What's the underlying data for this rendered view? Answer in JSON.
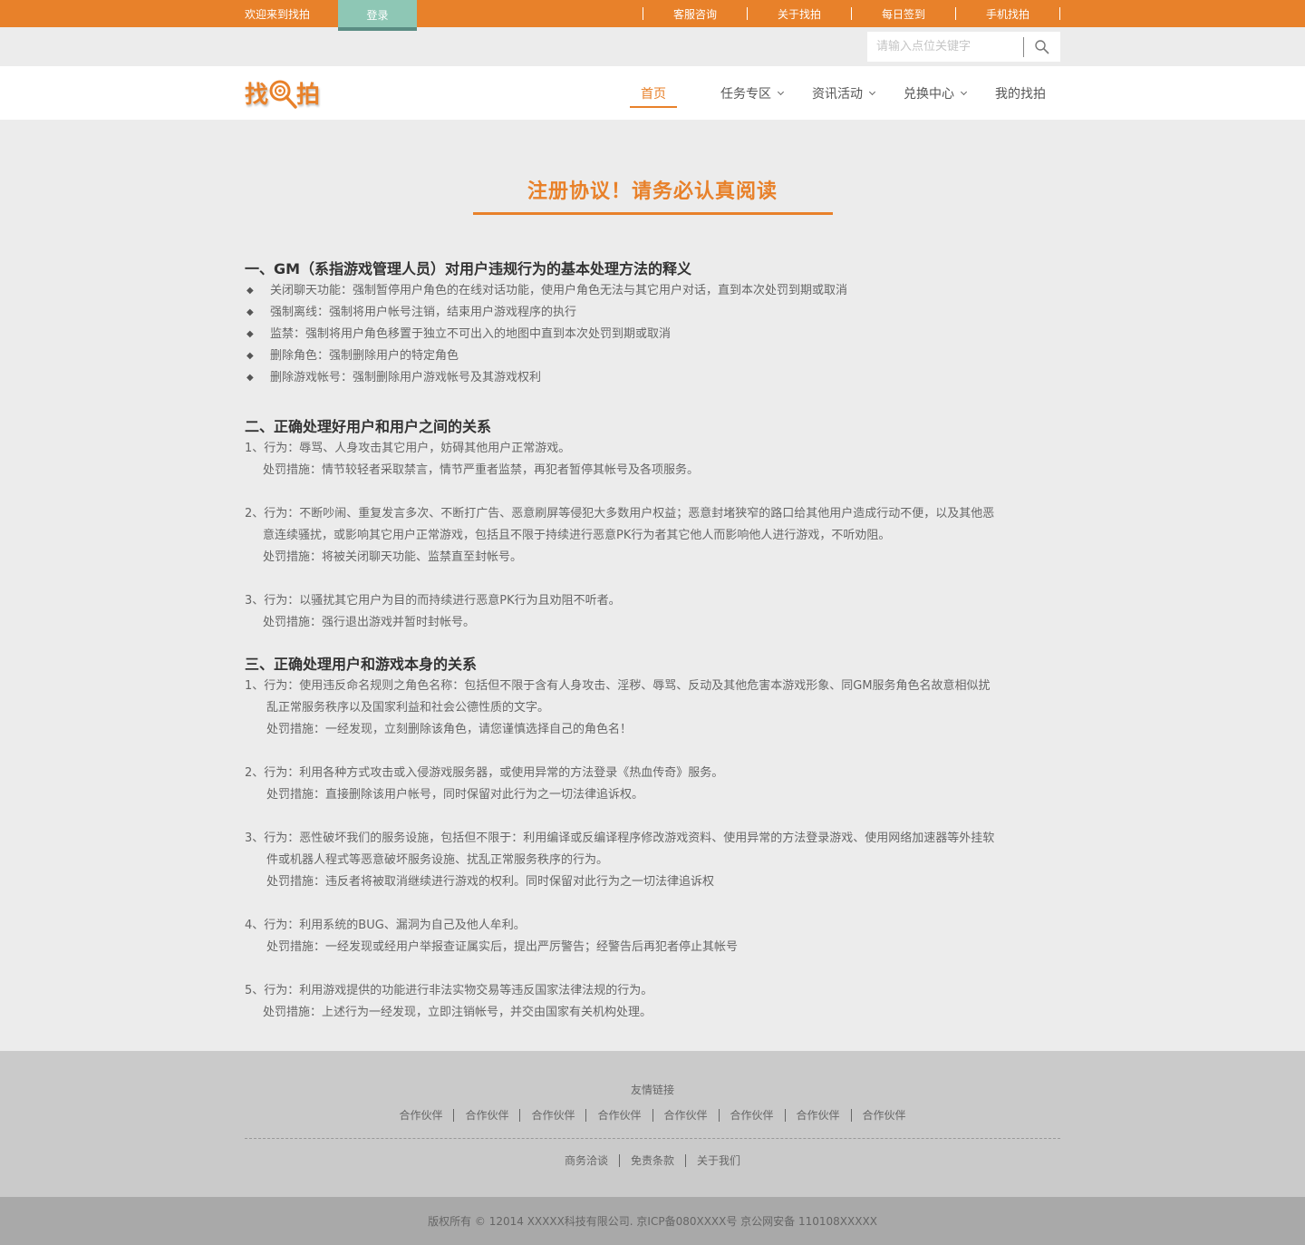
{
  "topbar": {
    "welcome": "欢迎来到找拍",
    "login": "登录",
    "links": [
      "客服咨询",
      "关于找拍",
      "每日签到",
      "手机找拍"
    ]
  },
  "search": {
    "placeholder": "请输入点位关键字",
    "icon": "search-icon"
  },
  "logo": {
    "left": "找",
    "right": "拍"
  },
  "nav": [
    {
      "label": "首页",
      "active": true,
      "dropdown": false
    },
    {
      "label": "任务专区",
      "active": false,
      "dropdown": true
    },
    {
      "label": "资讯活动",
      "active": false,
      "dropdown": true
    },
    {
      "label": "兑换中心",
      "active": false,
      "dropdown": true
    },
    {
      "label": "我的找拍",
      "active": false,
      "dropdown": false
    }
  ],
  "doc": {
    "title": "注册协议！请务必认真阅读",
    "sec1": {
      "heading": "一、GM（系指游戏管理人员）对用户违规行为的基本处理方法的释义",
      "items": [
        "关闭聊天功能：强制暂停用户角色的在线对话功能，使用户角色无法与其它用户对话，直到本次处罚到期或取消",
        "强制离线：强制将用户帐号注销，结束用户游戏程序的执行",
        "监禁：强制将用户角色移置于独立不可出入的地图中直到本次处罚到期或取消",
        "删除角色：强制删除用户的特定角色",
        "删除游戏帐号：强制删除用户游戏帐号及其游戏权利"
      ]
    },
    "sec2": {
      "heading": "二、正确处理好用户和用户之间的关系",
      "p1_line1": "1、行为：辱骂、人身攻击其它用户，妨碍其他用户正常游戏。",
      "p1_pen": "处罚措施：情节较轻者采取禁言，情节严重者监禁，再犯者暂停其帐号及各项服务。",
      "p2_line1": "2、行为：不断吵闹、重复发言多次、不断打广告、恶意刷屏等侵犯大多数用户权益；恶意封堵狭窄的路口给其他用户造成行动不便，以及其他恶",
      "p2_line2": "意连续骚扰，或影响其它用户正常游戏，包括且不限于持续进行恶意PK行为者其它他人而影响他人进行游戏，不听劝阻。",
      "p2_pen": "处罚措施：将被关闭聊天功能、监禁直至封帐号。",
      "p3_line1": "3、行为：以骚扰其它用户为目的而持续进行恶意PK行为且劝阻不听者。",
      "p3_pen": "处罚措施：强行退出游戏并暂时封帐号。"
    },
    "sec3": {
      "heading": "三、正确处理用户和游戏本身的关系",
      "p1_line1": "1、行为：使用违反命名规则之角色名称：包括但不限于含有人身攻击、淫秽、辱骂、反动及其他危害本游戏形象、同GM服务角色名故意相似扰",
      "p1_line2": "乱正常服务秩序以及国家利益和社会公德性质的文字。",
      "p1_pen": "处罚措施：一经发现，立刻删除该角色，请您谨慎选择自己的角色名！",
      "p2_line1": "2、行为：利用各种方式攻击或入侵游戏服务器，或使用异常的方法登录《热血传奇》服务。",
      "p2_pen": "处罚措施：直接删除该用户帐号，同时保留对此行为之一切法律追诉权。",
      "p3_line1": "3、行为：恶性破坏我们的服务设施，包括但不限于：利用编译或反编译程序修改游戏资料、使用异常的方法登录游戏、使用网络加速器等外挂软",
      "p3_line2": "件或机器人程式等恶意破坏服务设施、扰乱正常服务秩序的行为。",
      "p3_pen": "处罚措施：违反者将被取消继续进行游戏的权利。同时保留对此行为之一切法律追诉权",
      "p4_line1": "4、行为：利用系统的BUG、漏洞为自己及他人牟利。",
      "p4_pen": "处罚措施：一经发现或经用户举报查证属实后，提出严厉警告；经警告后再犯者停止其帐号",
      "p5_line1": "5、行为：利用游戏提供的功能进行非法实物交易等违反国家法律法规的行为。",
      "p5_pen": "处罚措施：上述行为一经发现，立即注销帐号，并交由国家有关机构处理。"
    }
  },
  "footer": {
    "title": "友情链接",
    "partners": [
      "合作伙伴",
      "合作伙伴",
      "合作伙伴",
      "合作伙伴",
      "合作伙伴",
      "合作伙伴",
      "合作伙伴",
      "合作伙伴"
    ],
    "links": [
      "商务洽谈",
      "免责条款",
      "关于我们"
    ],
    "copyright": "版权所有 © 12014 XXXXX科技有限公司. 京ICP备080XXXX号 京公网安备 110108XXXXX"
  },
  "colors": {
    "accent": "#e8812a",
    "login": "#8ec7b5"
  }
}
